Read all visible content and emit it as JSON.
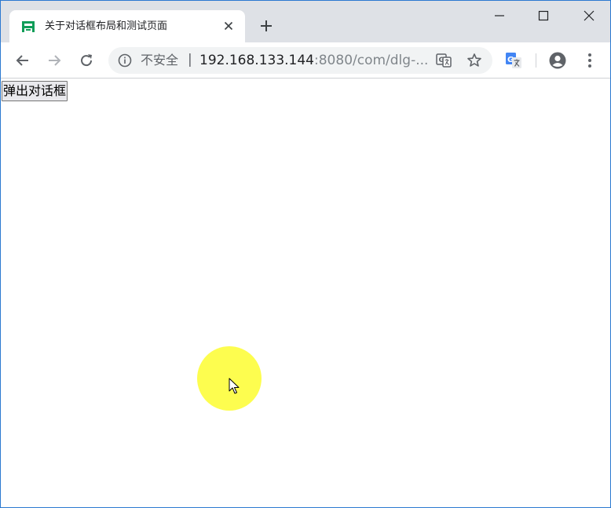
{
  "browser": {
    "tab": {
      "title": "关于对话框布局和测试页面",
      "favicon": "green-robot-favicon-icon",
      "close_icon": "close-icon"
    },
    "newtab_icon": "plus-icon",
    "window_controls": [
      "minimize-icon",
      "maximize-icon",
      "close-icon"
    ],
    "toolbar": {
      "back_icon": "back-arrow-icon",
      "forward_icon": "forward-arrow-icon",
      "reload_icon": "reload-icon",
      "security_label": "不安全",
      "separator": "|",
      "url_host": "192.168.133.144",
      "url_path": ":8080/com/dlg-...",
      "translate_icon": "translate-icon",
      "bookmark_icon": "star-icon",
      "extension_icon": "google-translate-extension-icon",
      "account_icon": "account-icon",
      "menu_icon": "more-vert-icon"
    },
    "colors": {
      "tabstrip_bg": "#dee1e6",
      "omnibox_bg": "#f1f3f4",
      "favicon_green": "#0f9d58",
      "cursor_highlight": "#fdfd3c",
      "window_border": "#2b79d0"
    }
  },
  "page": {
    "popup_button_label": "弹出对话框"
  }
}
